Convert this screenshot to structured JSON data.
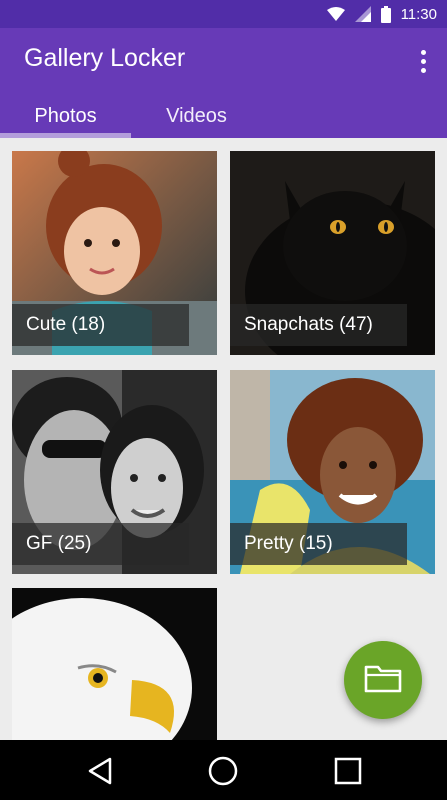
{
  "status_bar": {
    "time": "11:30",
    "icons": [
      "wifi-icon",
      "signal-icon",
      "battery-icon"
    ]
  },
  "app_bar": {
    "title": "Gallery Locker",
    "menu_icon": "more-vert-icon"
  },
  "tabs": [
    {
      "label": "Photos",
      "selected": true
    },
    {
      "label": "Videos",
      "selected": false
    }
  ],
  "albums": [
    {
      "label": "Cute (18)"
    },
    {
      "label": "Snapchats (47)"
    },
    {
      "label": "GF (25)"
    },
    {
      "label": "Pretty (15)"
    },
    {
      "label": ""
    }
  ],
  "fab": {
    "icon": "folder-icon",
    "color": "#6aa528"
  },
  "nav_bar": {
    "icons": [
      "back-icon",
      "home-icon",
      "recents-icon"
    ]
  },
  "colors": {
    "primary": "#673ab7",
    "primary_dark": "#512da8",
    "tab_indicator": "#b39ddb",
    "background": "#ececec"
  }
}
